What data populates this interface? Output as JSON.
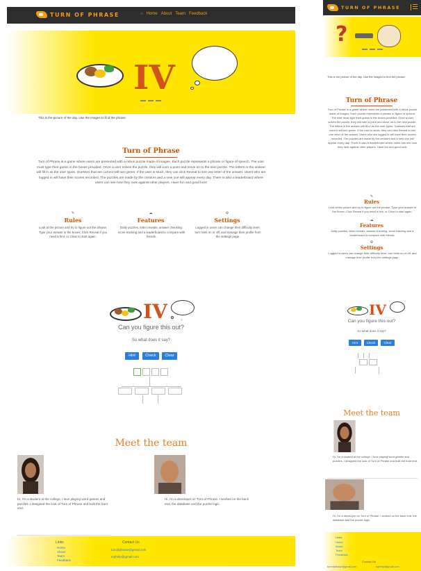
{
  "brand": {
    "name": "TURN OF PHRASE",
    "color": "#f39c12"
  },
  "nav": {
    "links": [
      "Home",
      "About",
      "Team",
      "Feedback"
    ],
    "home_icon": "home-icon",
    "menu_icon": "hamburger-menu-icon"
  },
  "hero": {
    "roman": "IV",
    "caption": "This is the picture of the day. Use the images to find the phrase.",
    "slide_count": 3
  },
  "about": {
    "title": "Turn of Phrase",
    "paragraph": "Turn of Phrase is a game where users are presented with a rebus puzzle made of images. Each puzzle represents a phrase or figure of speech. The user must type their guess in the boxes provided. Once a user solves the puzzle, they will earn a point and move on to the next puzzle. The letters in the answer will fill in as the user types. Guesses that are correct will turn green. If the user is stuck, they can click Reveal to see one letter of the answer. Users who are logged in will have their scores recorded. The puzzles are made by the creators and a new one will appear every day. There is also a leaderboard where users can see how they rank against other players. Have fun and good luck!",
    "features": [
      {
        "icon": "rules-icon",
        "title": "Rules",
        "text": "Look at the picture and try to figure out the phrase. Type your answer in the boxes. Click Reveal if you need a hint, or Clear to start again."
      },
      {
        "icon": "features-icon",
        "title": "Features",
        "text": "Daily puzzles, letter reveals, answer checking, score tracking and a leaderboard to compare with friends."
      },
      {
        "icon": "settings-icon",
        "title": "Settings",
        "text": "Logged in users can change their difficulty level, turn hints on or off, and manage their profile from the settings page."
      }
    ]
  },
  "game": {
    "question": "Can you figure this out?",
    "prompt": "So what does it say?",
    "buttons": [
      "Hint",
      "Check",
      "Clear"
    ],
    "bubble_label": "?"
  },
  "mobile_game": {
    "question": "Can you figure this out?",
    "prompt": "So what does it say?"
  },
  "team": {
    "title": "Meet the team",
    "members": [
      {
        "avatar": "team-member-1-avatar",
        "bio": "Hi, I'm a student at the college. I love playing word games and puzzles. I designed the look of Turn of Phrase and built the front end."
      },
      {
        "avatar": "team-member-2-avatar",
        "bio": "Hi, I'm a developer on Turn of Phrase. I worked on the back end, the database and the puzzle logic."
      }
    ]
  },
  "footer": {
    "links_title": "Links",
    "links": [
      "Home",
      "About",
      "Team",
      "Feedback"
    ],
    "contact_title": "Contact Us",
    "emails": [
      "turnofphrase@gmail.com",
      "tophelp@gmail.com"
    ]
  }
}
